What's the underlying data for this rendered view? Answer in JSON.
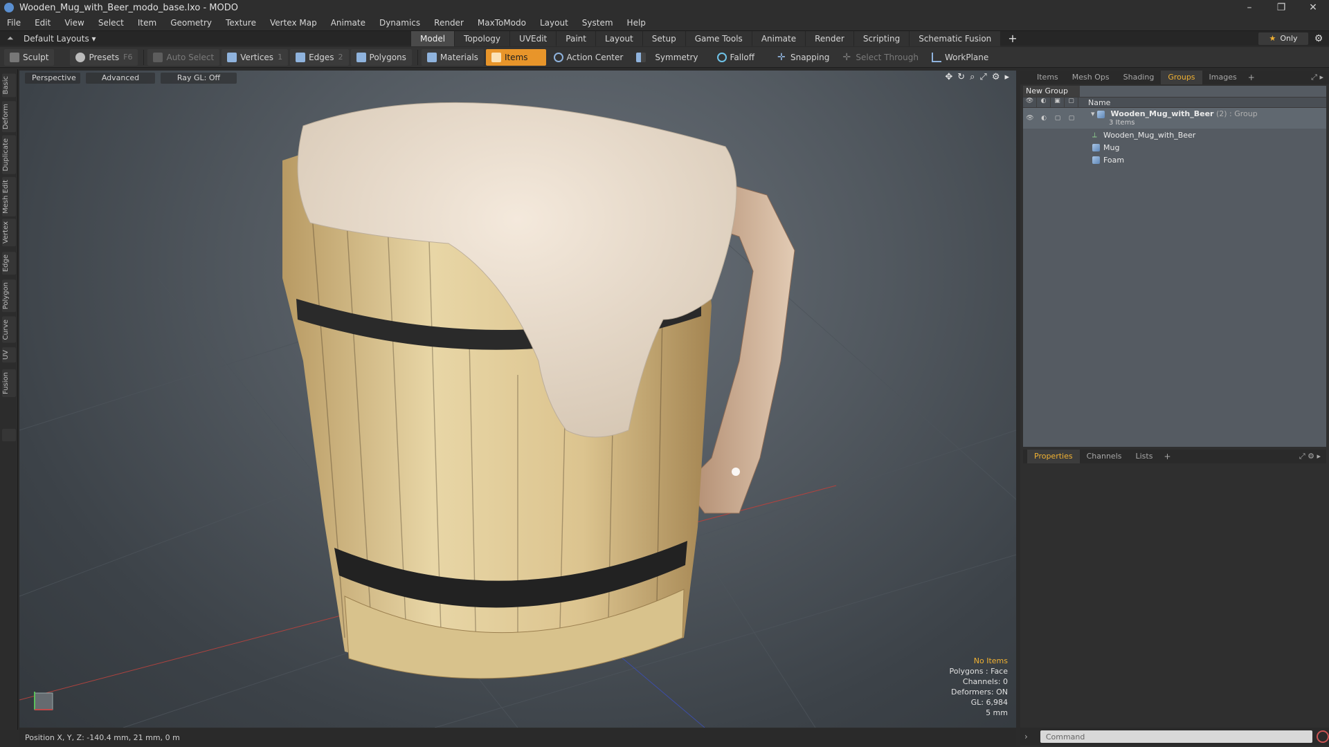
{
  "window": {
    "title": "Wooden_Mug_with_Beer_modo_base.lxo - MODO",
    "buttons": [
      "–",
      "❐",
      "✕"
    ]
  },
  "menu": [
    "File",
    "Edit",
    "View",
    "Select",
    "Item",
    "Geometry",
    "Texture",
    "Vertex Map",
    "Animate",
    "Dynamics",
    "Render",
    "MaxToModo",
    "Layout",
    "System",
    "Help"
  ],
  "layoutbar": {
    "layout_name": "Default Layouts ▾",
    "tabs": [
      "Model",
      "Topology",
      "UVEdit",
      "Paint",
      "Layout",
      "Setup",
      "Game Tools",
      "Animate",
      "Render",
      "Scripting",
      "Schematic Fusion"
    ],
    "active_tab": "Model",
    "only_label": "Only"
  },
  "toolbar": {
    "sculpt": "Sculpt",
    "presets": "Presets",
    "presets_key": "F6",
    "auto_select": "Auto Select",
    "vertices": "Vertices",
    "vertices_count": "1",
    "edges": "Edges",
    "edges_count": "2",
    "polygons": "Polygons",
    "materials": "Materials",
    "items": "Items",
    "action_center": "Action Center",
    "symmetry": "Symmetry",
    "falloff": "Falloff",
    "snapping": "Snapping",
    "select_through": "Select Through",
    "workplane": "WorkPlane"
  },
  "left_tabs": [
    "Basic",
    "Deform",
    "Duplicate",
    "Mesh Edit",
    "Vertex",
    "Edge",
    "Polygon",
    "Curve",
    "UV",
    "Fusion"
  ],
  "viewport": {
    "view": "Perspective",
    "style": "Advanced",
    "raygl": "Ray GL: Off",
    "info": {
      "selection": "No Items",
      "polygons": "Polygons : Face",
      "channels": "Channels: 0",
      "deformers": "Deformers: ON",
      "gl": "GL: 6,984",
      "grid": "5 mm"
    }
  },
  "status": {
    "position": "Position X, Y, Z:  -140.4 mm, 21 mm, 0 m"
  },
  "right_panel": {
    "top_tabs": [
      "Items",
      "Mesh Ops",
      "Shading",
      "Groups",
      "Images"
    ],
    "active_top_tab": "Groups",
    "new_group": "New Group",
    "name_header": "Name",
    "group": {
      "name": "Wooden_Mug_with_Beer",
      "meta": "(2) : Group",
      "count": "3 Items",
      "children": [
        "Wooden_Mug_with_Beer",
        "Mug",
        "Foam"
      ]
    },
    "bottom_tabs": [
      "Properties",
      "Channels",
      "Lists"
    ],
    "active_bottom_tab": "Properties",
    "command_placeholder": "Command"
  },
  "colors": {
    "accent": "#f2b232",
    "active_tool": "#e8952a",
    "viewport_bg": "#525960"
  }
}
